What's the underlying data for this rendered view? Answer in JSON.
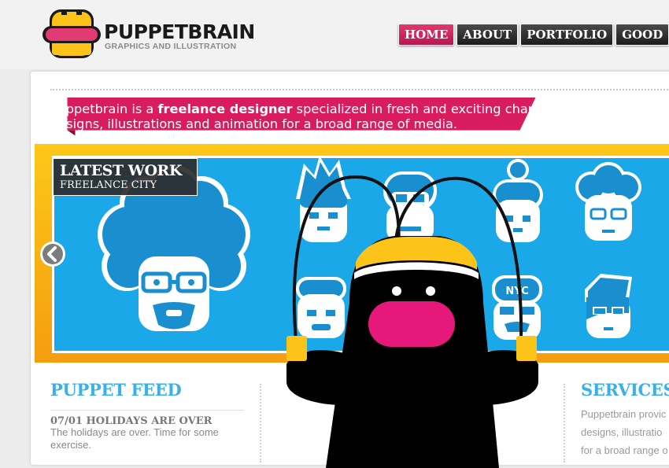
{
  "brand": {
    "name": "PUPPETBRAIN",
    "tagline": "GRAPHICS AND ILLUSTRATION"
  },
  "nav": {
    "items": [
      {
        "label": "HOME",
        "active": true
      },
      {
        "label": "ABOUT",
        "active": false
      },
      {
        "label": "PORTFOLIO",
        "active": false
      },
      {
        "label": "GOOD",
        "active": false
      }
    ]
  },
  "intro": {
    "prefix": "Puppetbrain is a ",
    "highlight": "freelance designer",
    "suffix": " specialized in fresh and exciting character designs, illustrations and animation for a broad range of media."
  },
  "slider": {
    "badge_title": "LATEST WORK",
    "badge_subtitle": "FREELANCE CITY",
    "prev_icon": "chevron-left-icon",
    "cap_text": "NYC"
  },
  "feed": {
    "title": "PUPPET FEED",
    "post_title": "07/01 HOLIDAYS ARE OVER",
    "post_body": "The holidays are over. Time for some exercise."
  },
  "services": {
    "title": "SERVICES",
    "lines": [
      "Puppetbrain provic",
      "designs, illustratio",
      "for a broad range o"
    ]
  },
  "colors": {
    "brand_pink": "#d81c5d",
    "accent_blue": "#1aa8e8",
    "heading_blue": "#39b0e6",
    "frame_yellow": "#fcc819",
    "nav_dark": "#2a2a2a"
  }
}
